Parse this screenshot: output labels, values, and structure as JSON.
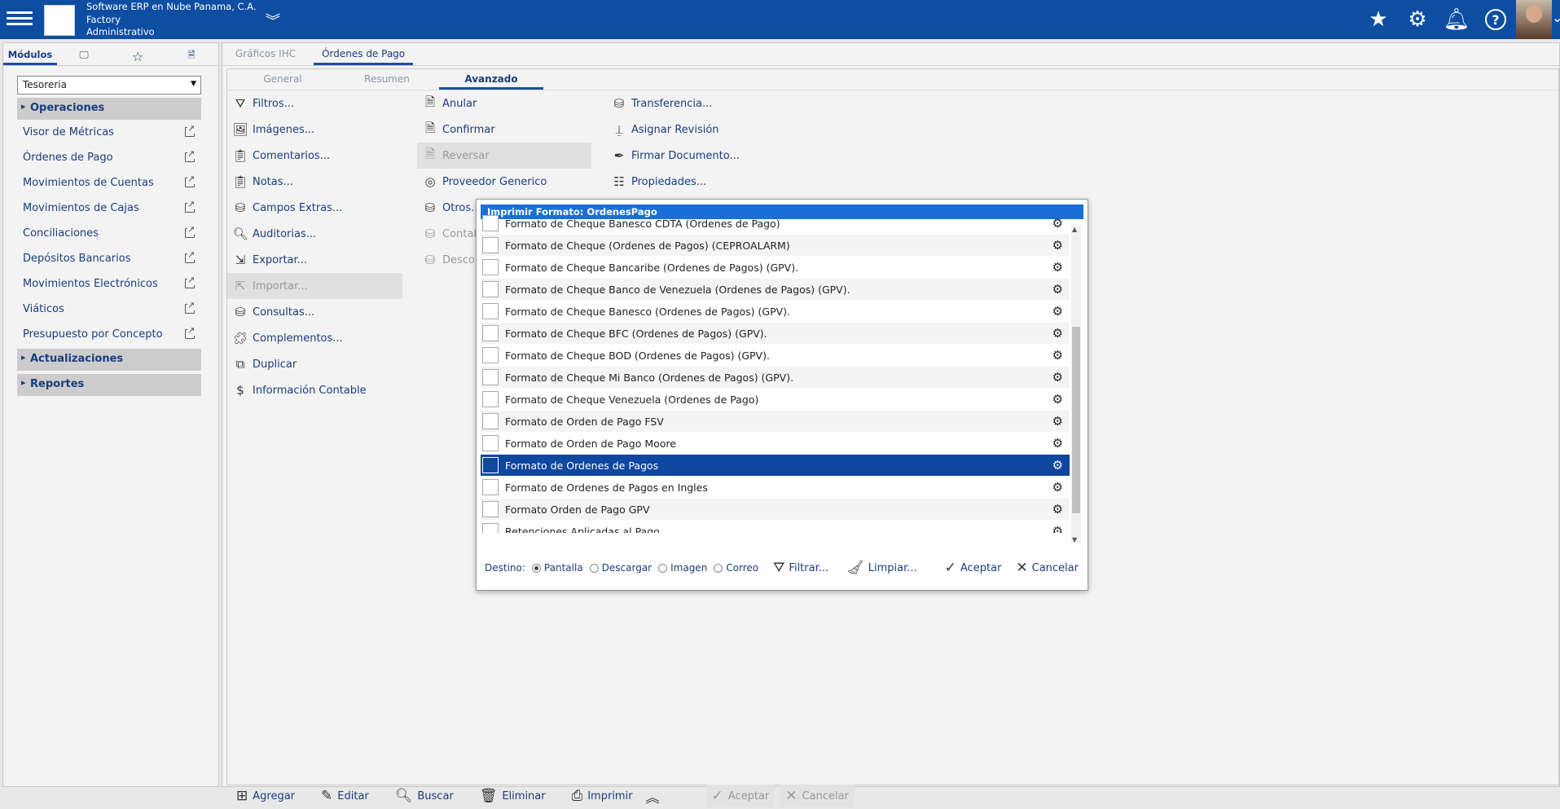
{
  "header": {
    "company_line1": "Software ERP en Nube Panama, C.A.",
    "company_line2": "Factory",
    "company_line3": "Administrativo"
  },
  "left": {
    "tabs": [
      "Módulos",
      "",
      "",
      ""
    ],
    "module_select": "Tesoreria",
    "section_operaciones": "Operaciones",
    "items": [
      "Visor de Métricas",
      "Órdenes de Pago",
      "Movimientos de Cuentas",
      "Movimientos de Cajas",
      "Conciliaciones",
      "Depósitos Bancarios",
      "Movimientos Electrónicos",
      "Viáticos",
      "Presupuesto por Concepto"
    ],
    "section_actualizaciones": "Actualizaciones",
    "section_reportes": "Reportes"
  },
  "main": {
    "tabs": [
      "Gráficos IHC",
      "Órdenes de Pago"
    ],
    "subtabs": [
      "General",
      "Resumen",
      "Avanzado"
    ],
    "col1": [
      "Filtros...",
      "Imágenes...",
      "Comentarios...",
      "Notas...",
      "Campos Extras...",
      "Auditorias...",
      "Exportar...",
      "Importar...",
      "Consultas...",
      "Complementos...",
      "Duplicar",
      "Información Contable"
    ],
    "col2": [
      "Anular",
      "Confirmar",
      "Reversar",
      "Proveedor Generico",
      "Otros...",
      "Contab",
      "Descor"
    ],
    "col3": [
      "Transferencia...",
      "Asignar Revisión",
      "Firmar Documento...",
      "Propiedades..."
    ]
  },
  "dialog": {
    "title": "Imprimir Formato: OrdenesPago",
    "rows": [
      "Formato de Cheque Banesco CDTA (Ordenes de Pago)",
      "Formato de Cheque (Ordenes de Pagos) (CEPROALARM)",
      "Formato de Cheque Bancaribe (Ordenes de Pagos) (GPV).",
      "Formato de Cheque Banco de Venezuela (Ordenes de Pagos) (GPV).",
      "Formato de Cheque Banesco (Ordenes de Pagos) (GPV).",
      "Formato de Cheque BFC (Ordenes de Pagos) (GPV).",
      "Formato de Cheque BOD (Ordenes de Pagos) (GPV).",
      "Formato de Cheque Mi Banco (Ordenes de Pagos) (GPV).",
      "Formato de Cheque Venezuela (Ordenes de Pago)",
      "Formato de Orden de Pago FSV",
      "Formato de Orden de Pago Moore",
      "Formato de Ordenes de Pagos",
      "Formato de Ordenes de Pagos en Ingles",
      "Formato Orden de Pago GPV",
      "Retenciones Aplicadas al Pago"
    ],
    "selected_index": 11,
    "destino_label": "Destino:",
    "destinos": [
      "Pantalla",
      "Descargar",
      "Imagen",
      "Correo"
    ],
    "filtrar": "Filtrar...",
    "limpiar": "Limpiar...",
    "aceptar": "Aceptar",
    "cancelar": "Cancelar"
  },
  "bottom": {
    "agregar": "Agregar",
    "editar": "Editar",
    "buscar": "Buscar",
    "eliminar": "Eliminar",
    "imprimir": "Imprimir",
    "aceptar": "Aceptar",
    "cancelar": "Cancelar"
  }
}
